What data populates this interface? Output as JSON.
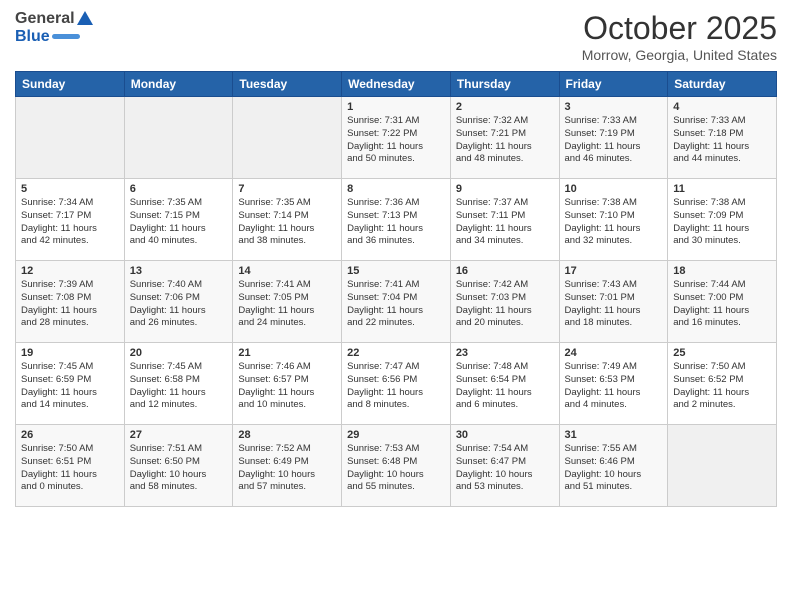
{
  "header": {
    "logo_general": "General",
    "logo_blue": "Blue",
    "month_title": "October 2025",
    "location": "Morrow, Georgia, United States"
  },
  "days_of_week": [
    "Sunday",
    "Monday",
    "Tuesday",
    "Wednesday",
    "Thursday",
    "Friday",
    "Saturday"
  ],
  "weeks": [
    [
      {
        "day": "",
        "info": ""
      },
      {
        "day": "",
        "info": ""
      },
      {
        "day": "",
        "info": ""
      },
      {
        "day": "1",
        "info": "Sunrise: 7:31 AM\nSunset: 7:22 PM\nDaylight: 11 hours\nand 50 minutes."
      },
      {
        "day": "2",
        "info": "Sunrise: 7:32 AM\nSunset: 7:21 PM\nDaylight: 11 hours\nand 48 minutes."
      },
      {
        "day": "3",
        "info": "Sunrise: 7:33 AM\nSunset: 7:19 PM\nDaylight: 11 hours\nand 46 minutes."
      },
      {
        "day": "4",
        "info": "Sunrise: 7:33 AM\nSunset: 7:18 PM\nDaylight: 11 hours\nand 44 minutes."
      }
    ],
    [
      {
        "day": "5",
        "info": "Sunrise: 7:34 AM\nSunset: 7:17 PM\nDaylight: 11 hours\nand 42 minutes."
      },
      {
        "day": "6",
        "info": "Sunrise: 7:35 AM\nSunset: 7:15 PM\nDaylight: 11 hours\nand 40 minutes."
      },
      {
        "day": "7",
        "info": "Sunrise: 7:35 AM\nSunset: 7:14 PM\nDaylight: 11 hours\nand 38 minutes."
      },
      {
        "day": "8",
        "info": "Sunrise: 7:36 AM\nSunset: 7:13 PM\nDaylight: 11 hours\nand 36 minutes."
      },
      {
        "day": "9",
        "info": "Sunrise: 7:37 AM\nSunset: 7:11 PM\nDaylight: 11 hours\nand 34 minutes."
      },
      {
        "day": "10",
        "info": "Sunrise: 7:38 AM\nSunset: 7:10 PM\nDaylight: 11 hours\nand 32 minutes."
      },
      {
        "day": "11",
        "info": "Sunrise: 7:38 AM\nSunset: 7:09 PM\nDaylight: 11 hours\nand 30 minutes."
      }
    ],
    [
      {
        "day": "12",
        "info": "Sunrise: 7:39 AM\nSunset: 7:08 PM\nDaylight: 11 hours\nand 28 minutes."
      },
      {
        "day": "13",
        "info": "Sunrise: 7:40 AM\nSunset: 7:06 PM\nDaylight: 11 hours\nand 26 minutes."
      },
      {
        "day": "14",
        "info": "Sunrise: 7:41 AM\nSunset: 7:05 PM\nDaylight: 11 hours\nand 24 minutes."
      },
      {
        "day": "15",
        "info": "Sunrise: 7:41 AM\nSunset: 7:04 PM\nDaylight: 11 hours\nand 22 minutes."
      },
      {
        "day": "16",
        "info": "Sunrise: 7:42 AM\nSunset: 7:03 PM\nDaylight: 11 hours\nand 20 minutes."
      },
      {
        "day": "17",
        "info": "Sunrise: 7:43 AM\nSunset: 7:01 PM\nDaylight: 11 hours\nand 18 minutes."
      },
      {
        "day": "18",
        "info": "Sunrise: 7:44 AM\nSunset: 7:00 PM\nDaylight: 11 hours\nand 16 minutes."
      }
    ],
    [
      {
        "day": "19",
        "info": "Sunrise: 7:45 AM\nSunset: 6:59 PM\nDaylight: 11 hours\nand 14 minutes."
      },
      {
        "day": "20",
        "info": "Sunrise: 7:45 AM\nSunset: 6:58 PM\nDaylight: 11 hours\nand 12 minutes."
      },
      {
        "day": "21",
        "info": "Sunrise: 7:46 AM\nSunset: 6:57 PM\nDaylight: 11 hours\nand 10 minutes."
      },
      {
        "day": "22",
        "info": "Sunrise: 7:47 AM\nSunset: 6:56 PM\nDaylight: 11 hours\nand 8 minutes."
      },
      {
        "day": "23",
        "info": "Sunrise: 7:48 AM\nSunset: 6:54 PM\nDaylight: 11 hours\nand 6 minutes."
      },
      {
        "day": "24",
        "info": "Sunrise: 7:49 AM\nSunset: 6:53 PM\nDaylight: 11 hours\nand 4 minutes."
      },
      {
        "day": "25",
        "info": "Sunrise: 7:50 AM\nSunset: 6:52 PM\nDaylight: 11 hours\nand 2 minutes."
      }
    ],
    [
      {
        "day": "26",
        "info": "Sunrise: 7:50 AM\nSunset: 6:51 PM\nDaylight: 11 hours\nand 0 minutes."
      },
      {
        "day": "27",
        "info": "Sunrise: 7:51 AM\nSunset: 6:50 PM\nDaylight: 10 hours\nand 58 minutes."
      },
      {
        "day": "28",
        "info": "Sunrise: 7:52 AM\nSunset: 6:49 PM\nDaylight: 10 hours\nand 57 minutes."
      },
      {
        "day": "29",
        "info": "Sunrise: 7:53 AM\nSunset: 6:48 PM\nDaylight: 10 hours\nand 55 minutes."
      },
      {
        "day": "30",
        "info": "Sunrise: 7:54 AM\nSunset: 6:47 PM\nDaylight: 10 hours\nand 53 minutes."
      },
      {
        "day": "31",
        "info": "Sunrise: 7:55 AM\nSunset: 6:46 PM\nDaylight: 10 hours\nand 51 minutes."
      },
      {
        "day": "",
        "info": ""
      }
    ]
  ]
}
